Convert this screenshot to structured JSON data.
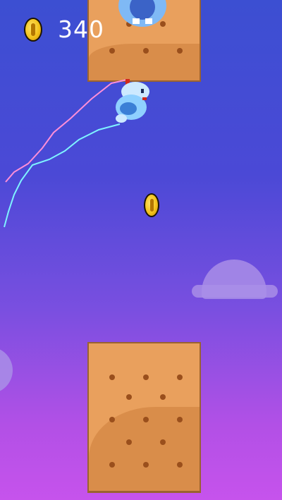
{
  "hud": {
    "coin_icon": "coin-icon",
    "score": "340"
  },
  "colors": {
    "sky_top": "#3c4fd2",
    "sky_bottom": "#c653ec",
    "cracker": "#e9a05d",
    "cracker_shade": "#d98d4a",
    "trail_pink": "#ff8fd8",
    "trail_cyan": "#7ff3ff",
    "bird": "#8fd0ff"
  }
}
